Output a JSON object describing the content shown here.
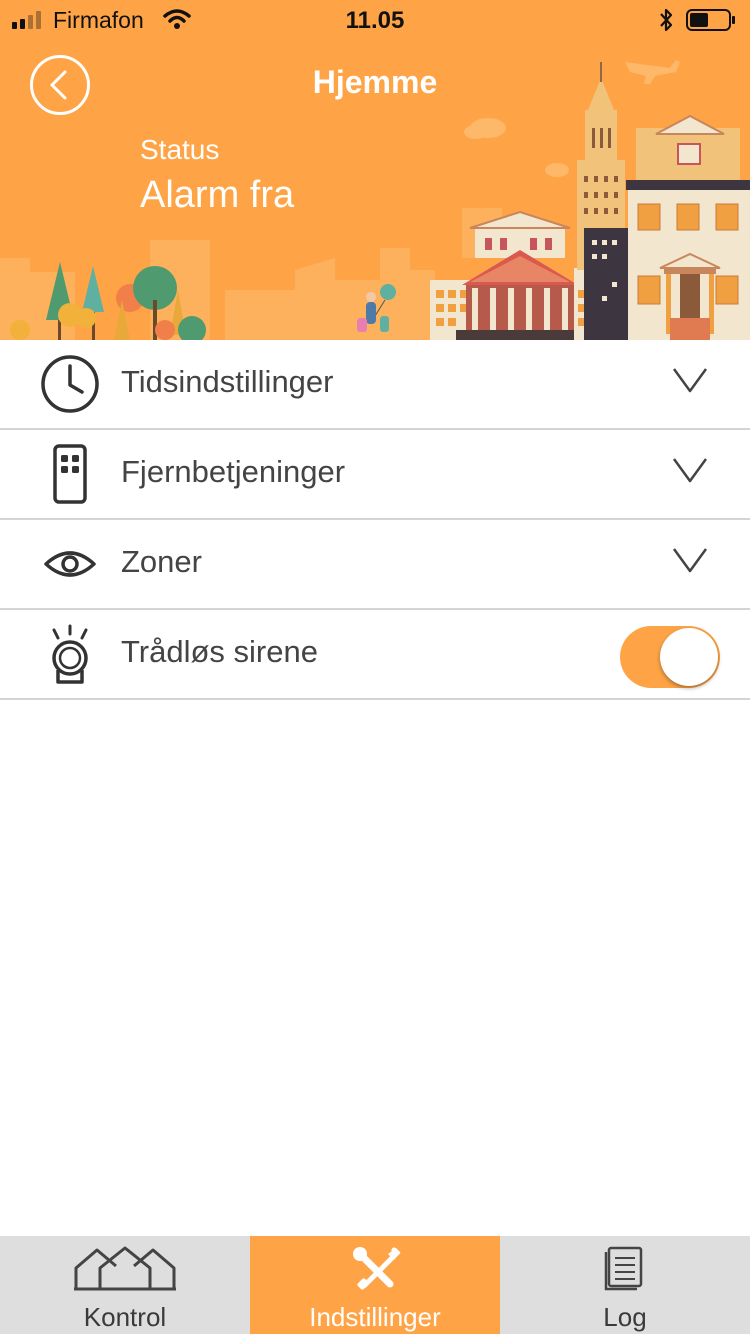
{
  "status_bar": {
    "carrier": "Firmafon",
    "time": "11.05"
  },
  "header": {
    "title": "Hjemme",
    "status_label": "Status",
    "status_value": "Alarm fra",
    "back_icon": "chevron-left-circle-icon"
  },
  "settings": {
    "items": [
      {
        "label": "Tidsindstillinger",
        "icon": "clock-icon",
        "control": "chevron-down-icon"
      },
      {
        "label": "Fjernbetjeninger",
        "icon": "remote-control-icon",
        "control": "chevron-down-icon"
      },
      {
        "label": "Zoner",
        "icon": "eye-icon",
        "control": "chevron-down-icon"
      },
      {
        "label": "Trådløs sirene",
        "icon": "siren-icon",
        "control": "toggle",
        "toggle_on": true
      }
    ]
  },
  "tab_bar": {
    "active_index": 1,
    "tabs": [
      {
        "label": "Kontrol",
        "icon": "houses-icon"
      },
      {
        "label": "Indstillinger",
        "icon": "tools-icon"
      },
      {
        "label": "Log",
        "icon": "document-icon"
      }
    ]
  },
  "colors": {
    "accent": "#fea446",
    "tab_bar_bg": "#dedede",
    "divider": "#d4d4d4",
    "text": "#444444"
  }
}
